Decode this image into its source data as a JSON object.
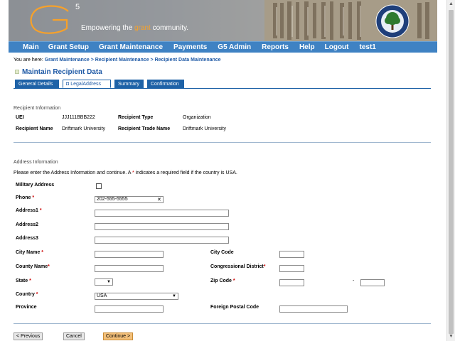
{
  "banner": {
    "logo_mark": "5",
    "tagline_before": "Empowering the ",
    "tagline_highlight": "grant",
    "tagline_after": " community.",
    "seal_icon": "department-of-education-seal-icon"
  },
  "nav": {
    "items": [
      "Main",
      "Grant Setup",
      "Grant Maintenance",
      "Payments",
      "G5 Admin",
      "Reports",
      "Help",
      "Logout",
      "test1"
    ]
  },
  "breadcrumb": {
    "prefix": "You are here: ",
    "items": [
      "Grant Maintenance",
      "Recipient Maintenance",
      "Recipient Data Maintenance"
    ],
    "separator": " > "
  },
  "page_title": "Maintain Recipient Data",
  "tabs": [
    {
      "label": "General Details",
      "active": false
    },
    {
      "label": "LegalAddress",
      "active": true
    },
    {
      "label": "Summary",
      "active": false
    },
    {
      "label": "Confirmation",
      "active": false
    }
  ],
  "recipient_info": {
    "heading": "Recipient Information",
    "uei_label": "UEI",
    "uei_value": "JJJ111BBB222",
    "type_label": "Recipient Type",
    "type_value": "Organization",
    "name_label": "Recipient Name",
    "name_value": "Driftmark University",
    "trade_label": "Recipient Trade Name",
    "trade_value": "Driftmark University"
  },
  "address_info": {
    "heading": "Address Information",
    "instruction_before": "Please enter the Address Information and continue. A ",
    "instruction_star": "*",
    "instruction_after": " indicates a required field if the country is USA.",
    "military_label": "Military Address",
    "phone_label": "Phone",
    "phone_value": "202-555-5555",
    "address1_label": "Address1",
    "address2_label": "Address2",
    "address3_label": "Address3",
    "city_label": "City Name",
    "city_code_label": "City Code",
    "county_label": "County Name",
    "district_label": "Congressional District",
    "state_label": "State",
    "state_value": "",
    "zip_label": "Zip Code",
    "zip_separator": "-",
    "country_label": "Country",
    "country_value": "USA",
    "province_label": "Province",
    "postal_label": "Foreign Postal Code",
    "required_mark": "*",
    "clear_icon": "close-icon"
  },
  "buttons": {
    "previous": "< Previous",
    "cancel": "Cancel",
    "continue": "Continue >"
  },
  "colors": {
    "nav_bg": "#3f82c3",
    "link": "#1f5aa6",
    "tab_bg": "#1e62a7",
    "required": "#cc0000",
    "continue_bg": "#f3c07a"
  }
}
